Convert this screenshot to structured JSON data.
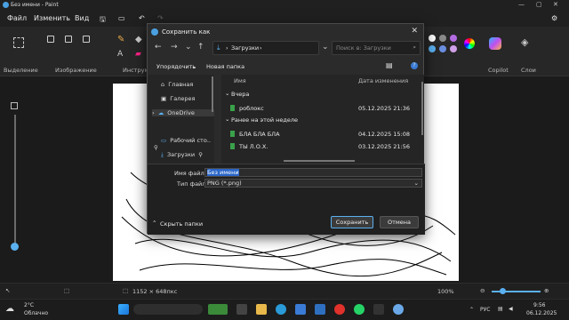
{
  "window": {
    "title": "Без имени - Paint"
  },
  "menu": {
    "file": "Файл",
    "edit": "Изменить",
    "view": "Вид"
  },
  "ribbon": {
    "selection": "Выделение",
    "image": "Изображение",
    "tools": "Инструм",
    "copilot": "Copilot",
    "layers": "Слои"
  },
  "dialog": {
    "title": "Сохранить как",
    "breadcrumb_folder": "Загрузки",
    "search_placeholder": "Поиск в: Загрузки",
    "organize": "Упорядочить",
    "new_folder": "Новая папка",
    "nav": [
      "Главная",
      "Галерея",
      "OneDrive",
      "Рабочий сто..",
      "Загрузки"
    ],
    "columns": {
      "name": "Имя",
      "date": "Дата изменения"
    },
    "groups": {
      "yesterday": "Вчера",
      "earlier": "Ранее на этой неделе"
    },
    "files": [
      {
        "name": "роблокс",
        "date": "05.12.2025 21:36"
      },
      {
        "name": "БЛА БЛА БЛА",
        "date": "04.12.2025 15:08"
      },
      {
        "name": "ТЫ Л.О.Х.",
        "date": "03.12.2025 21:56"
      }
    ],
    "filename_label": "Имя файла:",
    "filename_value": "Без имени",
    "filetype_label": "Тип файла:",
    "filetype_value": "PNG (*.png)",
    "hide_folders": "Скрыть папки",
    "save": "Сохранить",
    "cancel": "Отмена"
  },
  "status": {
    "dimensions": "1152 × 648пкс",
    "zoom": "100%"
  },
  "taskbar": {
    "weather_temp": "2°C",
    "weather_desc": "Облачно",
    "lang": "РУС",
    "time": "9:56",
    "date": "06.12.2025"
  }
}
